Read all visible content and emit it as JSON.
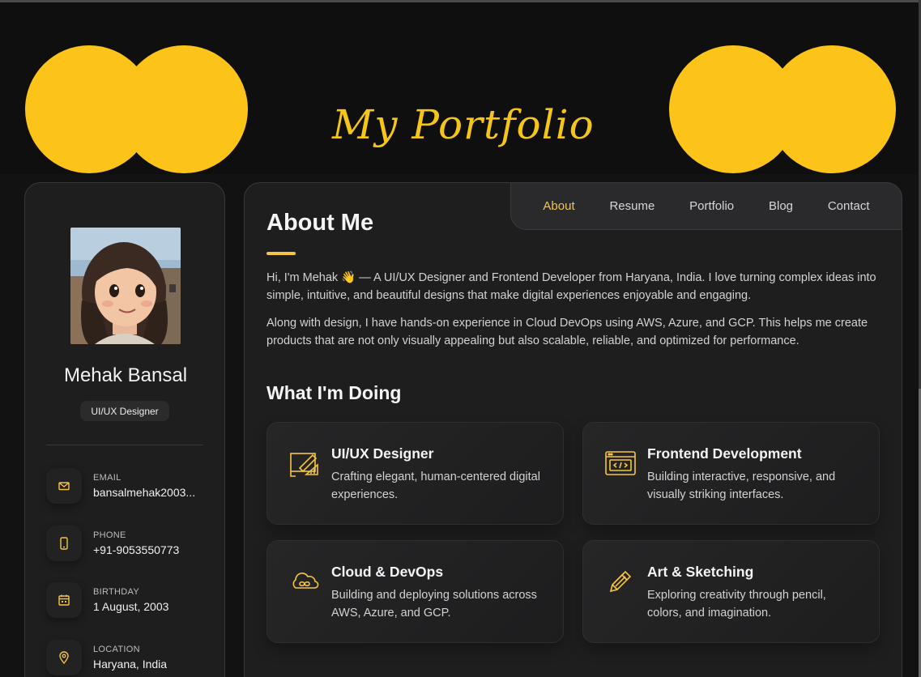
{
  "header": {
    "title": "My Portfolio"
  },
  "colors": {
    "accent": "#f5c542",
    "circle": "#fcc419",
    "background": "#121212",
    "panel": "#1e1e1f"
  },
  "sidebar": {
    "name": "Mehak Bansal",
    "role": "UI/UX Designer",
    "contacts": [
      {
        "icon": "mail-icon",
        "label": "EMAIL",
        "value": "bansalmehak2003..."
      },
      {
        "icon": "phone-icon",
        "label": "PHONE",
        "value": "+91-9053550773"
      },
      {
        "icon": "calendar-icon",
        "label": "BIRTHDAY",
        "value": "1 August, 2003"
      },
      {
        "icon": "location-icon",
        "label": "LOCATION",
        "value": "Haryana, India"
      }
    ]
  },
  "nav": {
    "items": [
      {
        "label": "About",
        "active": true
      },
      {
        "label": "Resume",
        "active": false
      },
      {
        "label": "Portfolio",
        "active": false
      },
      {
        "label": "Blog",
        "active": false
      },
      {
        "label": "Contact",
        "active": false
      }
    ]
  },
  "about": {
    "title": "About Me",
    "paragraphs": [
      "Hi, I'm Mehak 👋 — A UI/UX Designer and Frontend Developer from Haryana, India. I love turning complex ideas into simple, intuitive, and beautiful designs that make digital experiences enjoyable and engaging.",
      "Along with design, I have hands-on experience in Cloud DevOps using AWS, Azure, and GCP. This helps me create products that are not only visually appealing but also scalable, reliable, and optimized for performance."
    ]
  },
  "services": {
    "title": "What I'm Doing",
    "items": [
      {
        "icon": "design-icon",
        "title": "UI/UX Designer",
        "text": "Crafting elegant, human-centered digital experiences."
      },
      {
        "icon": "code-window-icon",
        "title": "Frontend Development",
        "text": "Building interactive, responsive, and visually striking interfaces."
      },
      {
        "icon": "cloud-infinity-icon",
        "title": "Cloud & DevOps",
        "text": "Building and deploying solutions across AWS, Azure, and GCP."
      },
      {
        "icon": "pencil-icon",
        "title": "Art & Sketching",
        "text": "Exploring creativity through pencil, colors, and imagination."
      }
    ]
  }
}
